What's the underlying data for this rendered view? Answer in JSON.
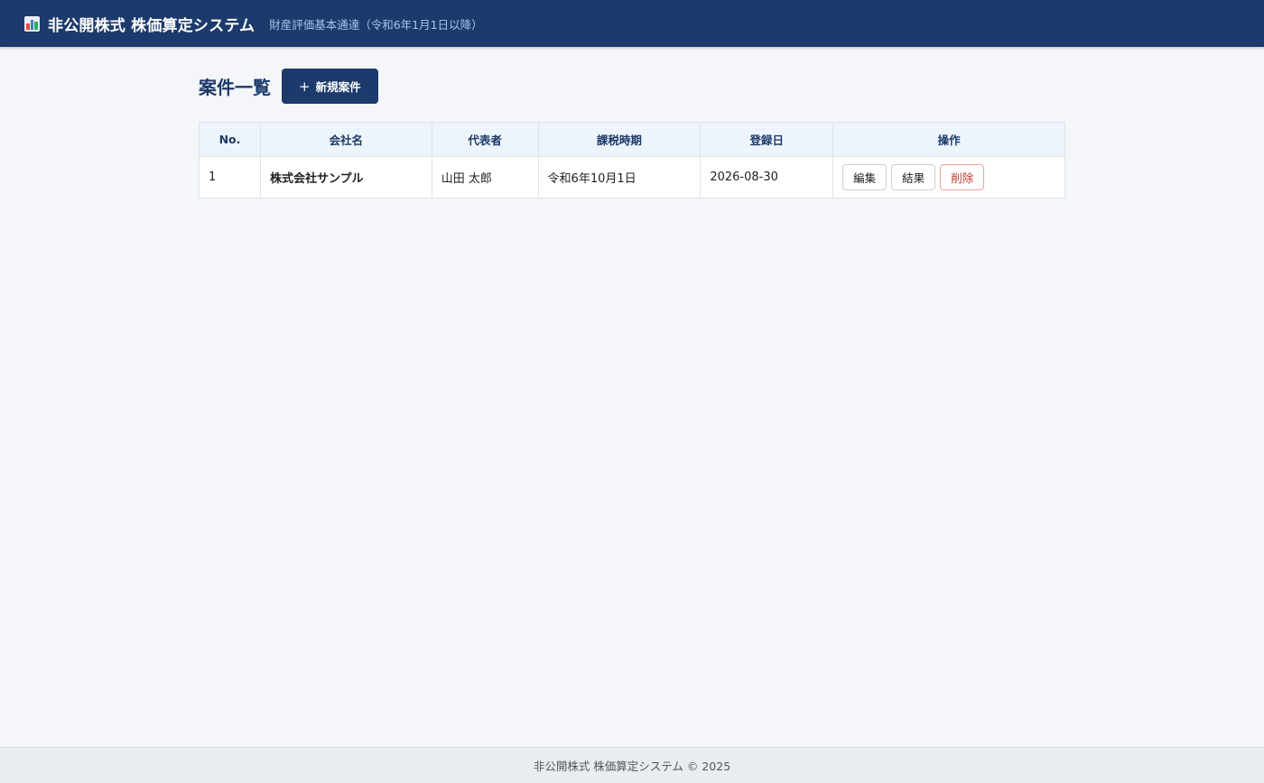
{
  "header": {
    "title": "非公開株式 株価算定システム",
    "subtitle": "財産評価基本通達（令和6年1月1日以降）",
    "logo_icon": "bar-chart-icon"
  },
  "main": {
    "page_title": "案件一覧",
    "new_button": {
      "icon": "+",
      "label": "新規案件"
    }
  },
  "table": {
    "columns": [
      "No.",
      "会社名",
      "代表者",
      "課税時期",
      "登録日",
      "操作"
    ],
    "rows": [
      {
        "no": "1",
        "company": "株式会社サンプル",
        "representative": "山田 太郎",
        "tax_date": "令和6年10月1日",
        "registered": "2026-08-30",
        "actions": {
          "edit": "編集",
          "result": "結果",
          "delete": "削除"
        }
      }
    ]
  },
  "footer": {
    "text": "非公開株式 株価算定システム © 2025"
  },
  "colors": {
    "primary": "#1c3a6b",
    "danger": "#c0392b",
    "background": "#f4f6f9"
  }
}
